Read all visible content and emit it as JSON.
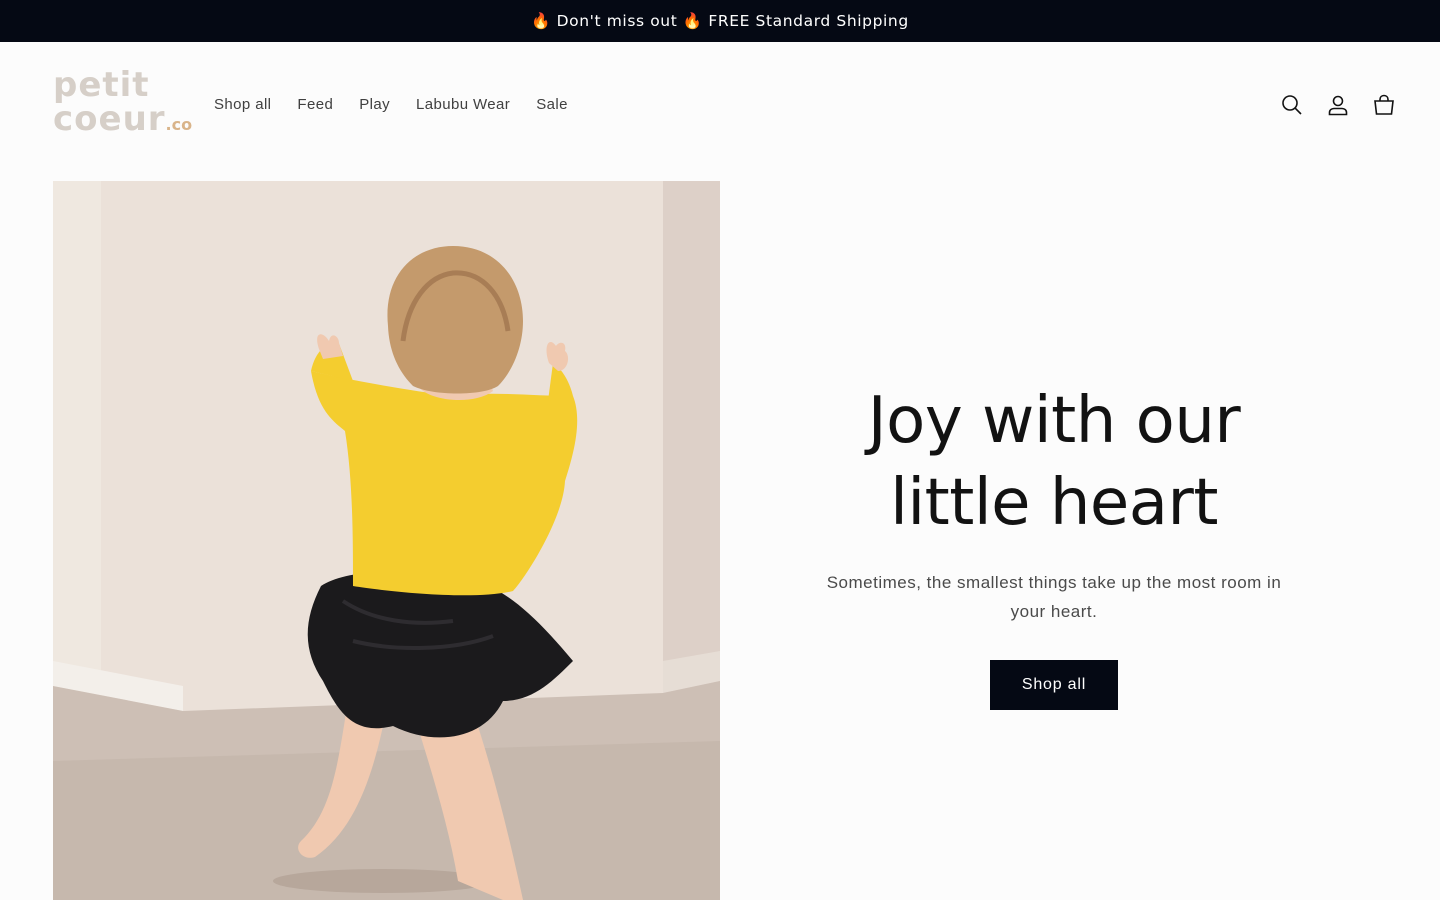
{
  "announcement": {
    "text": "🔥 Don't miss out 🔥 FREE Standard Shipping"
  },
  "logo": {
    "line1": "petit",
    "line2": "coeur",
    "suffix": ".co"
  },
  "nav": {
    "items": [
      {
        "label": "Shop all"
      },
      {
        "label": "Feed"
      },
      {
        "label": "Play"
      },
      {
        "label": "Labubu Wear"
      },
      {
        "label": "Sale"
      }
    ]
  },
  "header_icons": [
    "search-icon",
    "account-icon",
    "cart-icon"
  ],
  "hero": {
    "title_line1": "Joy with our",
    "title_line2": "little heart",
    "subtitle": "Sometimes, the smallest things take up the most room in your heart.",
    "button_label": "Shop all"
  },
  "colors": {
    "announcement_bg": "#050914",
    "page_bg": "#fcfcfc",
    "button_bg": "#050914",
    "logo": "#d6cfc8",
    "logo_accent": "#d9b48a"
  }
}
